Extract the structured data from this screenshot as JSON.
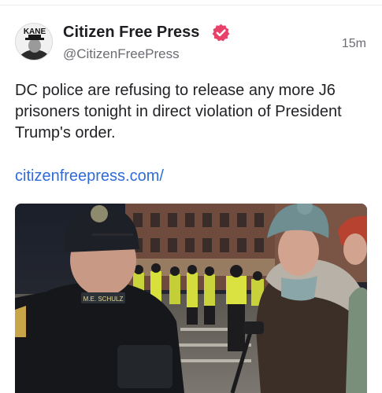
{
  "post": {
    "author": {
      "display_name": "Citizen Free Press",
      "handle": "@CitizenFreePress",
      "avatar_text": "KANE",
      "verified": true,
      "verified_color": "#e8416a"
    },
    "timestamp": "15m",
    "text": "DC police are refusing to release any more J6 prisoners tonight in direct violation of President Trump's order.",
    "link_text": "citizenfreepress.com/",
    "link_color": "#2f6bd9",
    "media": {
      "officer_badge_text": "M.E. SCHULZ"
    }
  }
}
